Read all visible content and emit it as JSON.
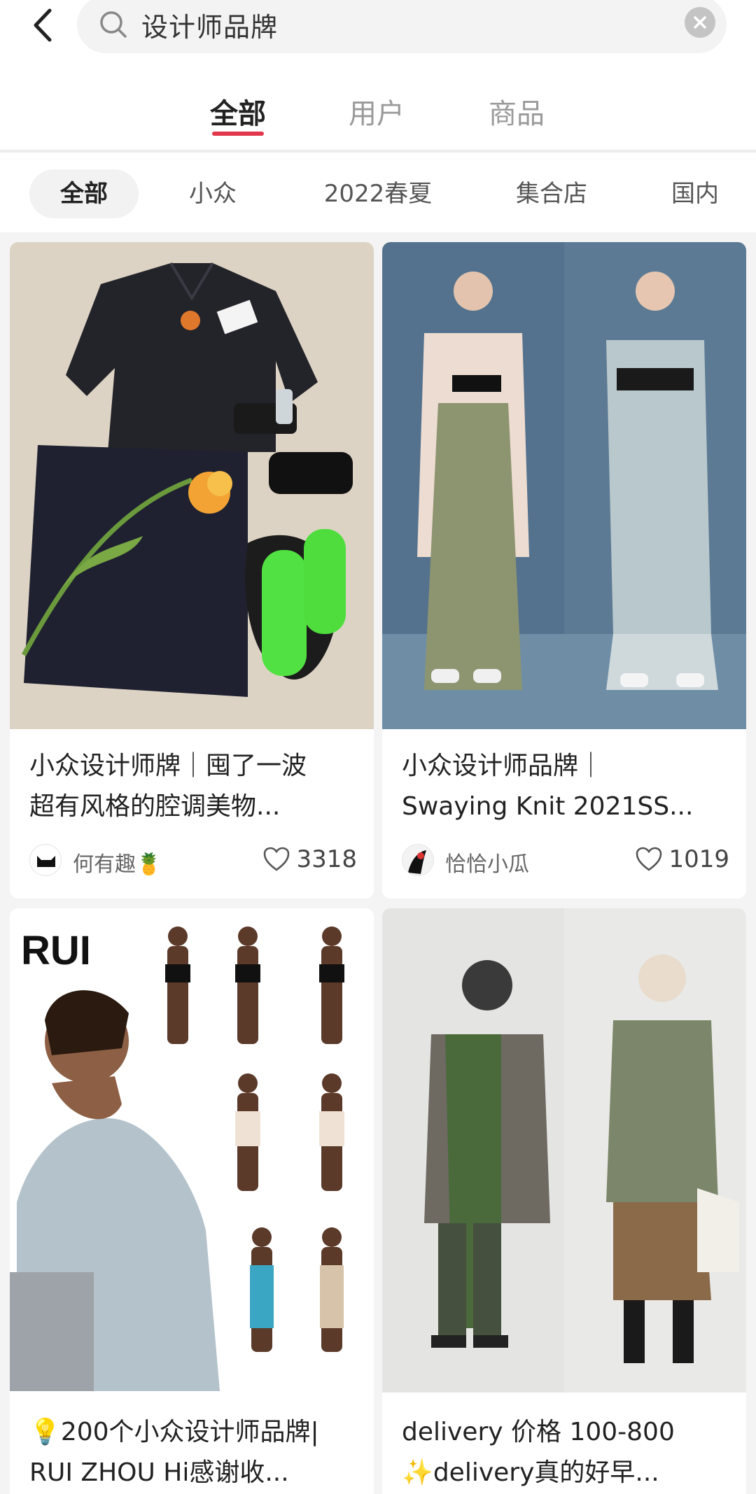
{
  "search": {
    "query": "设计师品牌"
  },
  "main_tabs": [
    {
      "label": "全部",
      "active": true
    },
    {
      "label": "用户",
      "active": false
    },
    {
      "label": "商品",
      "active": false
    }
  ],
  "filters": [
    {
      "label": "全部",
      "active": true
    },
    {
      "label": "小众",
      "active": false
    },
    {
      "label": "2022春夏",
      "active": false
    },
    {
      "label": "集合店",
      "active": false
    },
    {
      "label": "国内",
      "active": false
    }
  ],
  "feed": [
    {
      "title_line1": "小众设计师牌｜囤了一波",
      "title_line2": "超有风格的腔调美物...",
      "author": "何有趣🍍",
      "likes": "3318"
    },
    {
      "title_line1": "小众设计师品牌｜",
      "title_line2": "Swaying Knit 2021SS...",
      "author": "恰恰小瓜",
      "likes": "1019"
    },
    {
      "image_text": "RUI",
      "title_line1": "💡200个小众设计师品牌|",
      "title_line2": "RUI ZHOU Hi感谢收..."
    },
    {
      "title_line1": "delivery 价格 100-800",
      "title_line2": "✨delivery真的好早..."
    }
  ],
  "colors": {
    "accent": "#e2384b",
    "background": "#f4f4f4"
  }
}
